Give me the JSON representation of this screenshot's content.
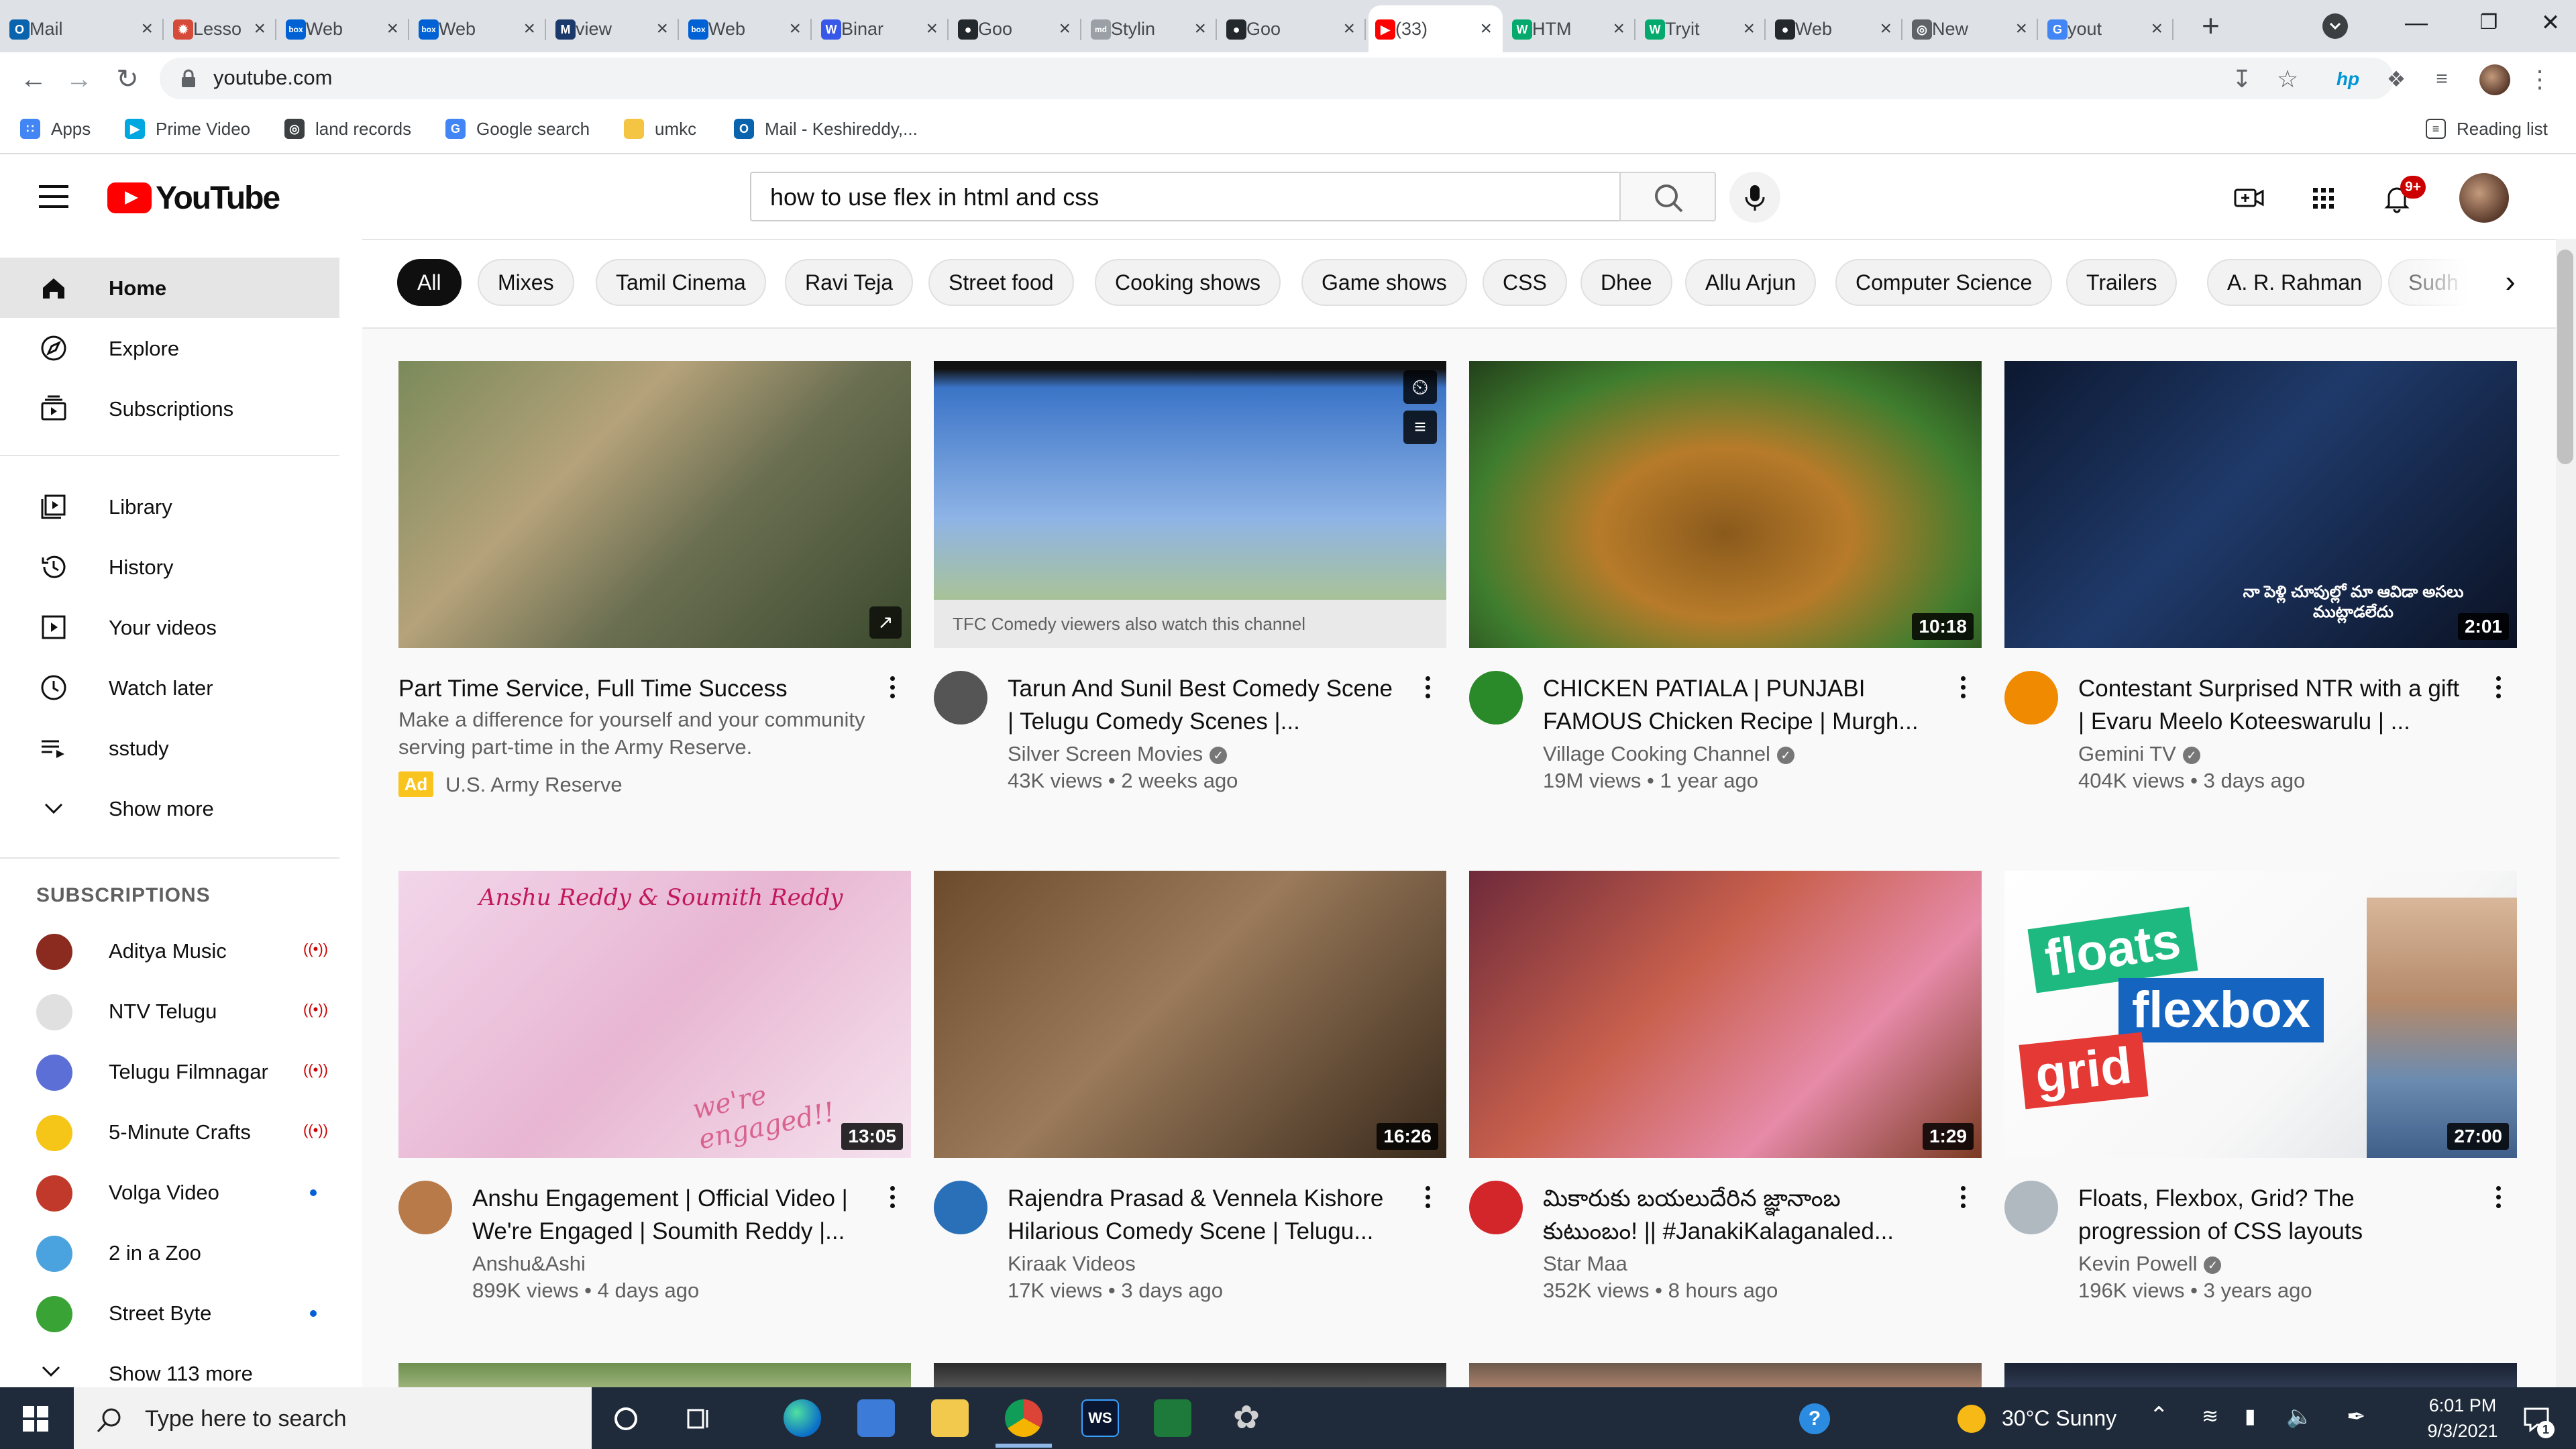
{
  "browser": {
    "tabs": [
      {
        "title": "Mail",
        "favicon": "outlook-icon",
        "color": "#0a64ad",
        "glyph": "O"
      },
      {
        "title": "Lesso",
        "favicon": "canvas-icon",
        "color": "#d64a3a",
        "glyph": "✹"
      },
      {
        "title": "Web",
        "favicon": "box-icon",
        "color": "#0061d5",
        "glyph": "box"
      },
      {
        "title": "Web",
        "favicon": "box-icon",
        "color": "#0061d5",
        "glyph": "box"
      },
      {
        "title": "view",
        "favicon": "m-icon",
        "color": "#1b3a6b",
        "glyph": "M"
      },
      {
        "title": "Web",
        "favicon": "box-icon",
        "color": "#0061d5",
        "glyph": "box"
      },
      {
        "title": "Binar",
        "favicon": "wordpress-icon",
        "color": "#3858e9",
        "glyph": "W"
      },
      {
        "title": "Goo",
        "favicon": "github-icon",
        "color": "#24292e",
        "glyph": "●"
      },
      {
        "title": "Stylin",
        "favicon": "markdown-icon",
        "color": "#9aa0a6",
        "glyph": "md"
      },
      {
        "title": "Goo",
        "favicon": "github-icon",
        "color": "#24292e",
        "glyph": "●"
      },
      {
        "title": "(33)",
        "favicon": "youtube-icon",
        "color": "#ff0000",
        "glyph": "▶"
      },
      {
        "title": "HTM",
        "favicon": "w3schools-icon",
        "color": "#04aa6d",
        "glyph": "W"
      },
      {
        "title": "Tryit",
        "favicon": "w3schools-icon",
        "color": "#04aa6d",
        "glyph": "W"
      },
      {
        "title": "Web",
        "favicon": "github-icon",
        "color": "#24292e",
        "glyph": "●"
      },
      {
        "title": "New",
        "favicon": "chrome-icon",
        "color": "#5f6368",
        "glyph": "◎"
      },
      {
        "title": "yout",
        "favicon": "google-icon",
        "color": "#4285f4",
        "glyph": "G"
      }
    ],
    "active_tab_index": 10,
    "url": "youtube.com",
    "bookmarks": [
      {
        "label": "Apps",
        "icon": "apps-grid-icon",
        "color": "#4285f4",
        "glyph": "∷"
      },
      {
        "label": "Prime Video",
        "icon": "prime-video-icon",
        "color": "#00a8e1",
        "glyph": "▶"
      },
      {
        "label": "land records",
        "icon": "globe-icon",
        "color": "#3c4043",
        "glyph": "◎"
      },
      {
        "label": "Google search",
        "icon": "google-icon",
        "color": "#4285f4",
        "glyph": "G"
      },
      {
        "label": "umkc",
        "icon": "folder-icon",
        "color": "#f4c542",
        "glyph": ""
      },
      {
        "label": "Mail - Keshireddy,...",
        "icon": "outlook-icon",
        "color": "#0a64ad",
        "glyph": "O"
      }
    ],
    "reading_list": "Reading list"
  },
  "youtube": {
    "logo_text": "YouTube",
    "search_query": "how to use flex in html and css",
    "notification_count": "9+",
    "sidebar": {
      "main": [
        {
          "label": "Home",
          "icon": "home-icon"
        },
        {
          "label": "Explore",
          "icon": "compass-icon"
        },
        {
          "label": "Subscriptions",
          "icon": "subscriptions-icon"
        }
      ],
      "library": [
        {
          "label": "Library",
          "icon": "library-icon"
        },
        {
          "label": "History",
          "icon": "history-icon"
        },
        {
          "label": "Your videos",
          "icon": "your-videos-icon"
        },
        {
          "label": "Watch later",
          "icon": "clock-icon"
        },
        {
          "label": "sstudy",
          "icon": "playlist-icon"
        },
        {
          "label": "Show more",
          "icon": "chevron-down-icon"
        }
      ],
      "subscriptions_heading": "SUBSCRIPTIONS",
      "subscriptions": [
        {
          "label": "Aditya Music",
          "status": "live",
          "color": "#8b2a1f"
        },
        {
          "label": "NTV Telugu",
          "status": "live",
          "color": "#e0e0e0"
        },
        {
          "label": "Telugu Filmnagar",
          "status": "live",
          "color": "#5b6fd6"
        },
        {
          "label": "5-Minute Crafts",
          "status": "live",
          "color": "#f5c518"
        },
        {
          "label": "Volga Video",
          "status": "new",
          "color": "#c0392b"
        },
        {
          "label": "2 in a Zoo",
          "status": "",
          "color": "#4aa3df"
        },
        {
          "label": "Street Byte",
          "status": "new",
          "color": "#3aa335"
        },
        {
          "label": "Show 113 more",
          "status": "",
          "color": ""
        }
      ],
      "live_glyph": "((•))"
    },
    "chips": [
      "All",
      "Mixes",
      "Tamil Cinema",
      "Ravi Teja",
      "Street food",
      "Cooking shows",
      "Game shows",
      "CSS",
      "Dhee",
      "Allu Arjun",
      "Computer Science",
      "Trailers",
      "A. R. Rahman",
      "Sudh"
    ],
    "videos": [
      {
        "title": "Part Time Service, Full Time Success",
        "desc": "Make a difference for yourself and your community serving part-time in the Army Reserve.",
        "ad_label": "Ad",
        "channel": "U.S. Army Reserve",
        "is_ad": true
      },
      {
        "title": "Tarun And Sunil Best Comedy Scene | Telugu Comedy Scenes |...",
        "channel": "Silver Screen Movies",
        "views": "43K views • 2 weeks ago",
        "overlay": "TFC Comedy viewers also watch this channel",
        "verified": true
      },
      {
        "title": "CHICKEN PATIALA | PUNJABI FAMOUS Chicken Recipe | Murgh...",
        "channel": "Village Cooking Channel",
        "views": "19M views • 1 year ago",
        "duration": "10:18",
        "verified": true
      },
      {
        "title": "Contestant Surprised NTR with a gift | Evaru Meelo Koteeswarulu | ...",
        "channel": "Gemini TV",
        "views": "404K views • 3 days ago",
        "duration": "2:01",
        "verified": true,
        "caption_text": "నా పెళ్లి చూపుల్లో మా ఆవిడా అసలు ముట్లాడలేదు"
      },
      {
        "title": "Anshu Engagement | Official Video | We're Engaged | Soumith Reddy |...",
        "channel": "Anshu&Ashi",
        "views": "899K views • 4 days ago",
        "duration": "13:05",
        "verified": false,
        "thumb_caption": "Anshu Reddy & Soumith Reddy",
        "thumb_caption2": "we're engaged!!"
      },
      {
        "title": "Rajendra Prasad & Vennela Kishore Hilarious Comedy Scene | Telugu...",
        "channel": "Kiraak Videos",
        "views": "17K views • 3 days ago",
        "duration": "16:26",
        "verified": false
      },
      {
        "title": "మికారుకు బయలుదేరిన జ్ఞానాంబ కుటుంబం! || #JanakiKalaganaled...",
        "channel": "Star Maa",
        "views": "352K views • 8 hours ago",
        "duration": "1:29",
        "verified": false
      },
      {
        "title": "Floats, Flexbox, Grid? The progression of CSS layouts",
        "channel": "Kevin Powell",
        "views": "196K views • 3 years ago",
        "duration": "27:00",
        "verified": true,
        "thumb_words": [
          "floats",
          "flexbox",
          "grid"
        ]
      }
    ]
  },
  "taskbar": {
    "search_placeholder": "Type here to search",
    "weather": "30°C  Sunny",
    "time": "6:01 PM",
    "date": "9/3/2021",
    "notifications": "1"
  },
  "colors": {
    "youtube_red": "#ff0000",
    "chip_active": "#0f0f0f",
    "taskbar": "#1f2b3a",
    "ad_badge": "#f9c41d"
  }
}
